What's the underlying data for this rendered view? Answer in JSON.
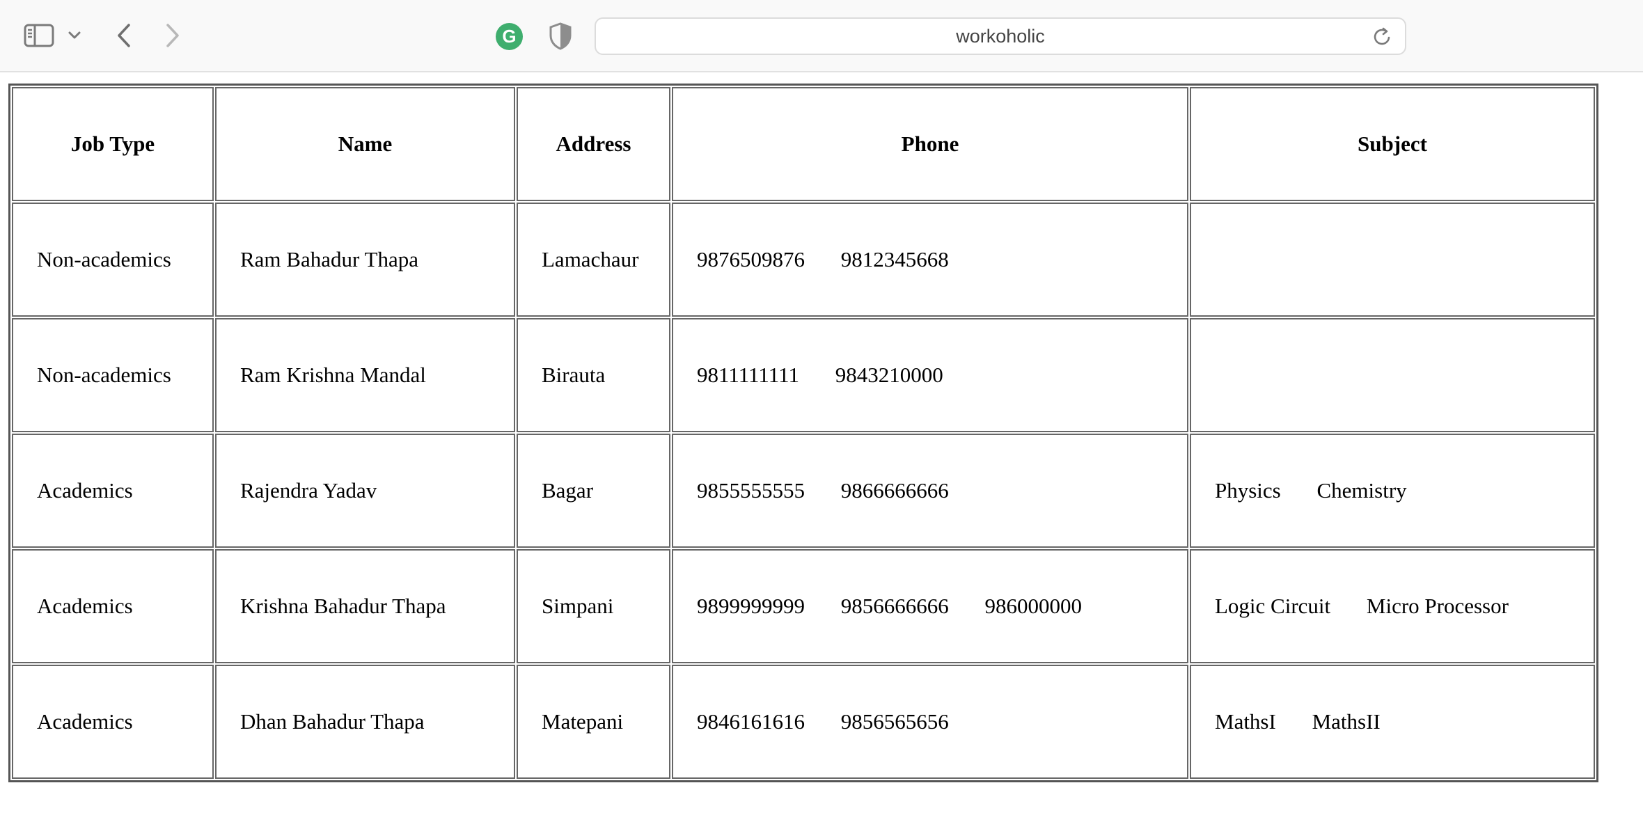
{
  "browser": {
    "address": "workoholic"
  },
  "table": {
    "headers": [
      "Job Type",
      "Name",
      "Address",
      "Phone",
      "Subject"
    ],
    "rows": [
      {
        "job_type": "Non-academics",
        "name": "Ram Bahadur Thapa",
        "address": "Lamachaur",
        "phones": [
          "9876509876",
          "9812345668"
        ],
        "subjects": []
      },
      {
        "job_type": "Non-academics",
        "name": "Ram Krishna Mandal",
        "address": "Birauta",
        "phones": [
          "9811111111",
          "9843210000"
        ],
        "subjects": []
      },
      {
        "job_type": "Academics",
        "name": "Rajendra Yadav",
        "address": "Bagar",
        "phones": [
          "9855555555",
          "9866666666"
        ],
        "subjects": [
          "Physics",
          "Chemistry"
        ]
      },
      {
        "job_type": "Academics",
        "name": "Krishna Bahadur Thapa",
        "address": "Simpani",
        "phones": [
          "9899999999",
          "9856666666",
          "986000000"
        ],
        "subjects": [
          "Logic Circuit",
          "Micro Processor"
        ]
      },
      {
        "job_type": "Academics",
        "name": "Dhan Bahadur Thapa",
        "address": "Matepani",
        "phones": [
          "9846161616",
          "9856565656"
        ],
        "subjects": [
          "MathsI",
          "MathsII"
        ]
      }
    ]
  },
  "icons": {
    "sidebar": "sidebar-icon",
    "chevron": "chevron-down-icon",
    "back": "back-arrow-icon",
    "forward": "forward-arrow-icon",
    "grammarly": "grammarly-icon",
    "shield": "privacy-shield-icon",
    "reload": "reload-icon"
  },
  "colors": {
    "grammarly": "#3fae6e",
    "toolbar_bg": "#f9f9f9",
    "table_border": "#555555"
  }
}
